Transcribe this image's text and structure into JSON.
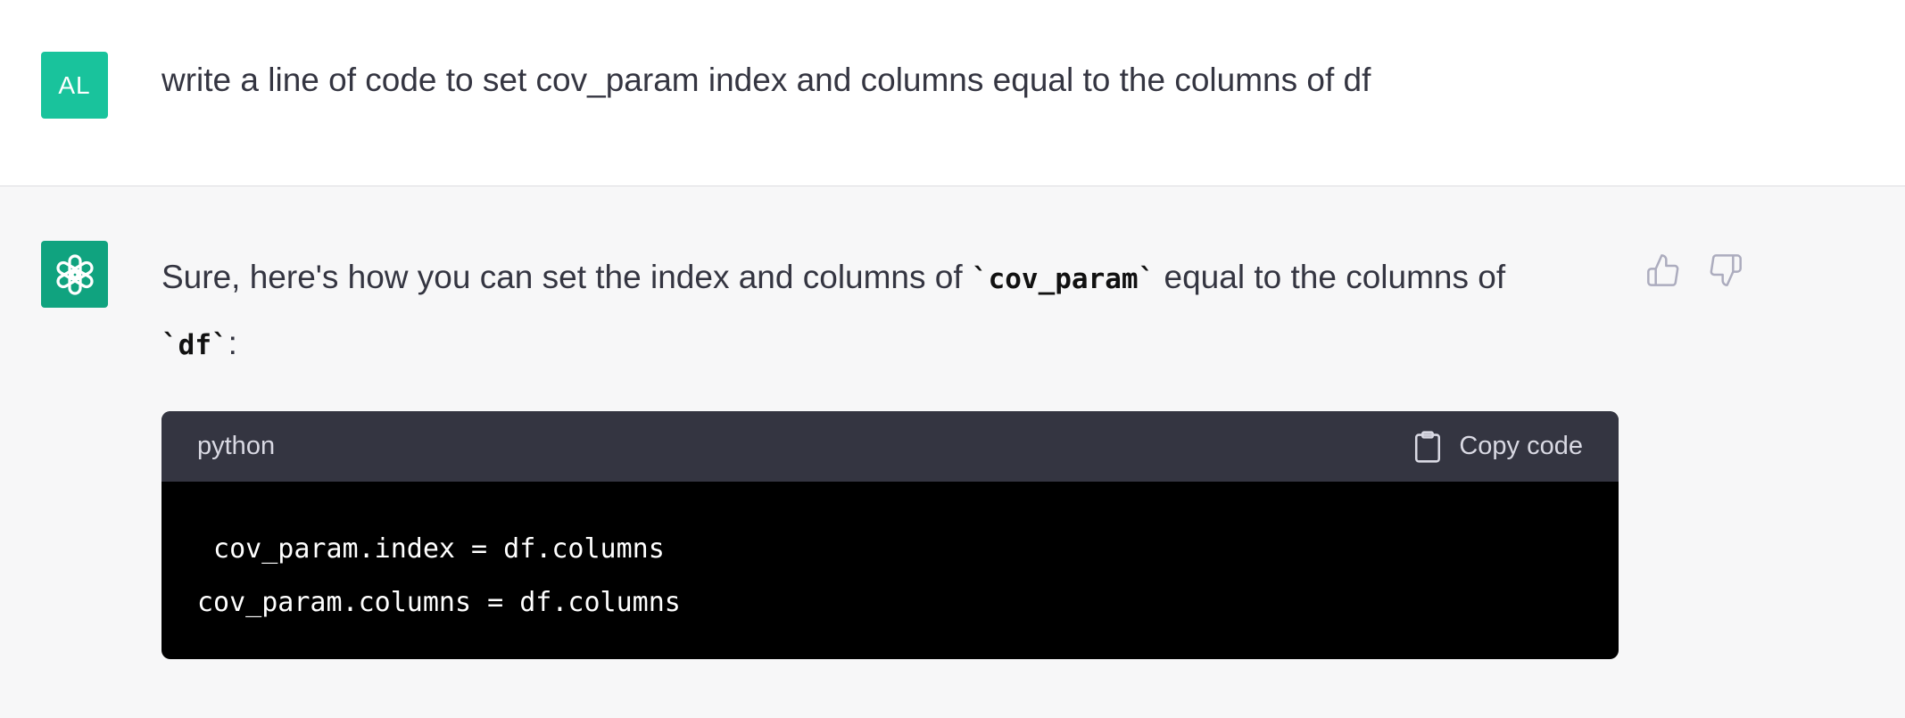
{
  "user": {
    "avatar_initials": "AL",
    "message": "write a line of code to set cov_param index and columns equal to the columns of df"
  },
  "assistant": {
    "avatar_icon": "openai-logo-icon",
    "reply_prefix": "Sure, here's how you can set the index and columns of ",
    "reply_code_1": "`cov_param`",
    "reply_middle": " equal to the columns of ",
    "reply_code_2": "`df`",
    "reply_suffix": ":",
    "feedback": {
      "thumbs_up_icon": "thumbs-up-icon",
      "thumbs_down_icon": "thumbs-down-icon"
    }
  },
  "code_block": {
    "language": "python",
    "copy_label": "Copy code",
    "lines": [
      " cov_param.index = df.columns",
      "cov_param.columns = df.columns"
    ]
  },
  "colors": {
    "user_avatar_bg": "#19c39c",
    "bot_avatar_bg": "#10a37f",
    "code_header_bg": "#343541",
    "code_body_bg": "#000000"
  }
}
